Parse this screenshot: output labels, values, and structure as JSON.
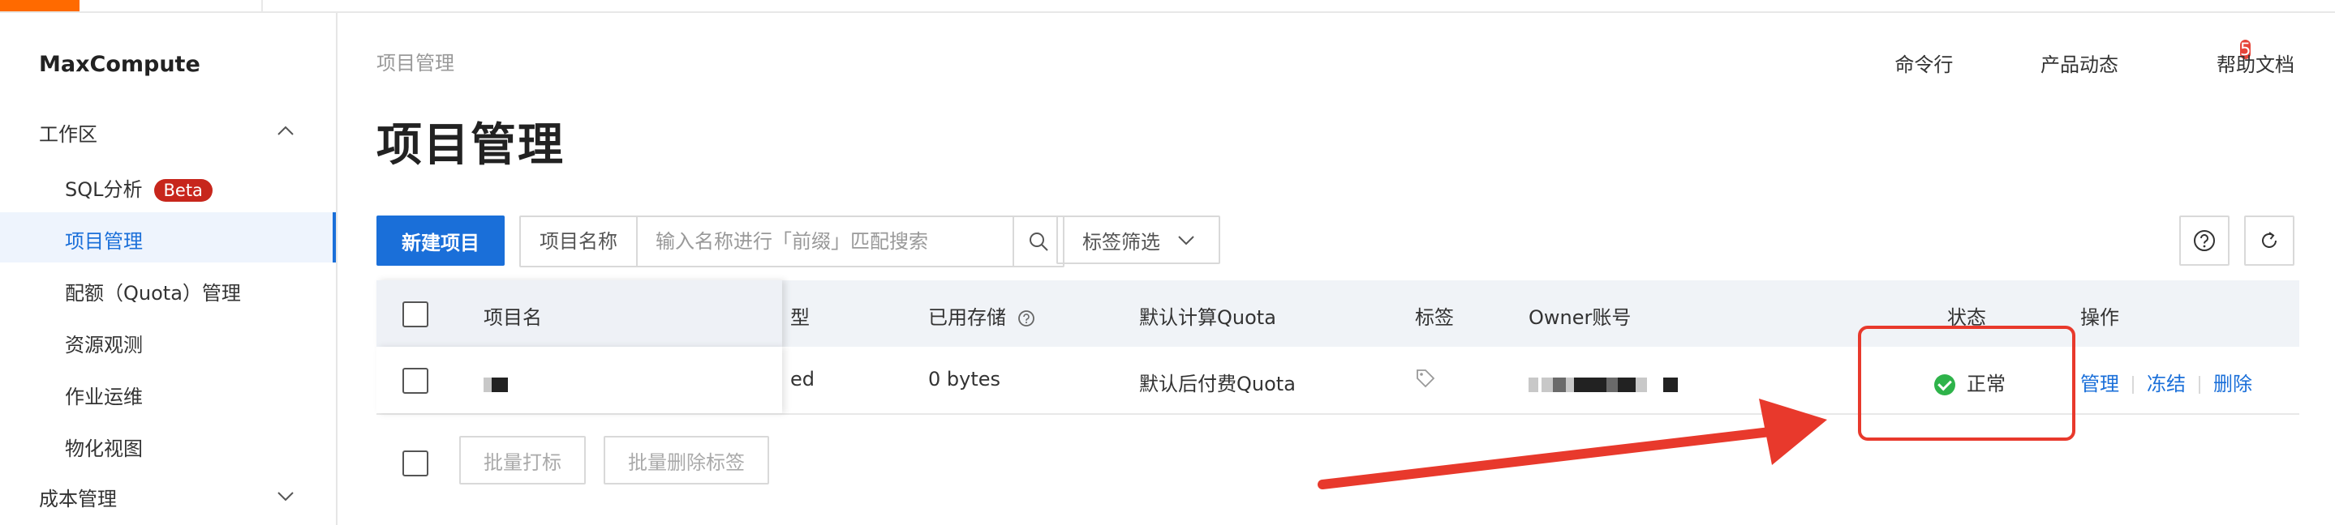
{
  "sidebar": {
    "title": "MaxCompute",
    "groups": [
      {
        "label": "工作区",
        "expanded": true
      },
      {
        "label": "成本管理",
        "expanded": false
      }
    ],
    "items": [
      {
        "label": "SQL分析",
        "badge": "Beta"
      },
      {
        "label": "项目管理",
        "active": true
      },
      {
        "label": "配额（Quota）管理"
      },
      {
        "label": "资源观测"
      },
      {
        "label": "作业运维"
      },
      {
        "label": "物化视图"
      }
    ]
  },
  "header": {
    "breadcrumb": "项目管理",
    "title": "项目管理",
    "links": {
      "cli": "命令行",
      "product_news": "产品动态",
      "product_news_badge": "5",
      "help": "帮助文档"
    }
  },
  "toolbar": {
    "new_project": "新建项目",
    "search_label": "项目名称",
    "search_placeholder": "输入名称进行「前缀」匹配搜索",
    "tag_filter": "标签筛选"
  },
  "table": {
    "columns": {
      "name": "项目名",
      "type_partial": "型",
      "storage": "已用存储",
      "quota": "默认计算Quota",
      "tags": "标签",
      "owner": "Owner账号",
      "status": "状态",
      "actions": "操作"
    },
    "rows": [
      {
        "type_partial": "ed",
        "storage": "0 bytes",
        "quota": "默认后付费Quota",
        "status": "正常",
        "actions": [
          "管理",
          "冻结",
          "删除"
        ]
      }
    ]
  },
  "batch": {
    "tag": "批量打标",
    "remove_tag": "批量删除标签"
  },
  "colors": {
    "primary": "#1a6fd9",
    "accent": "#ff6a00",
    "success": "#2eb34a",
    "annotation": "#e8392c"
  }
}
